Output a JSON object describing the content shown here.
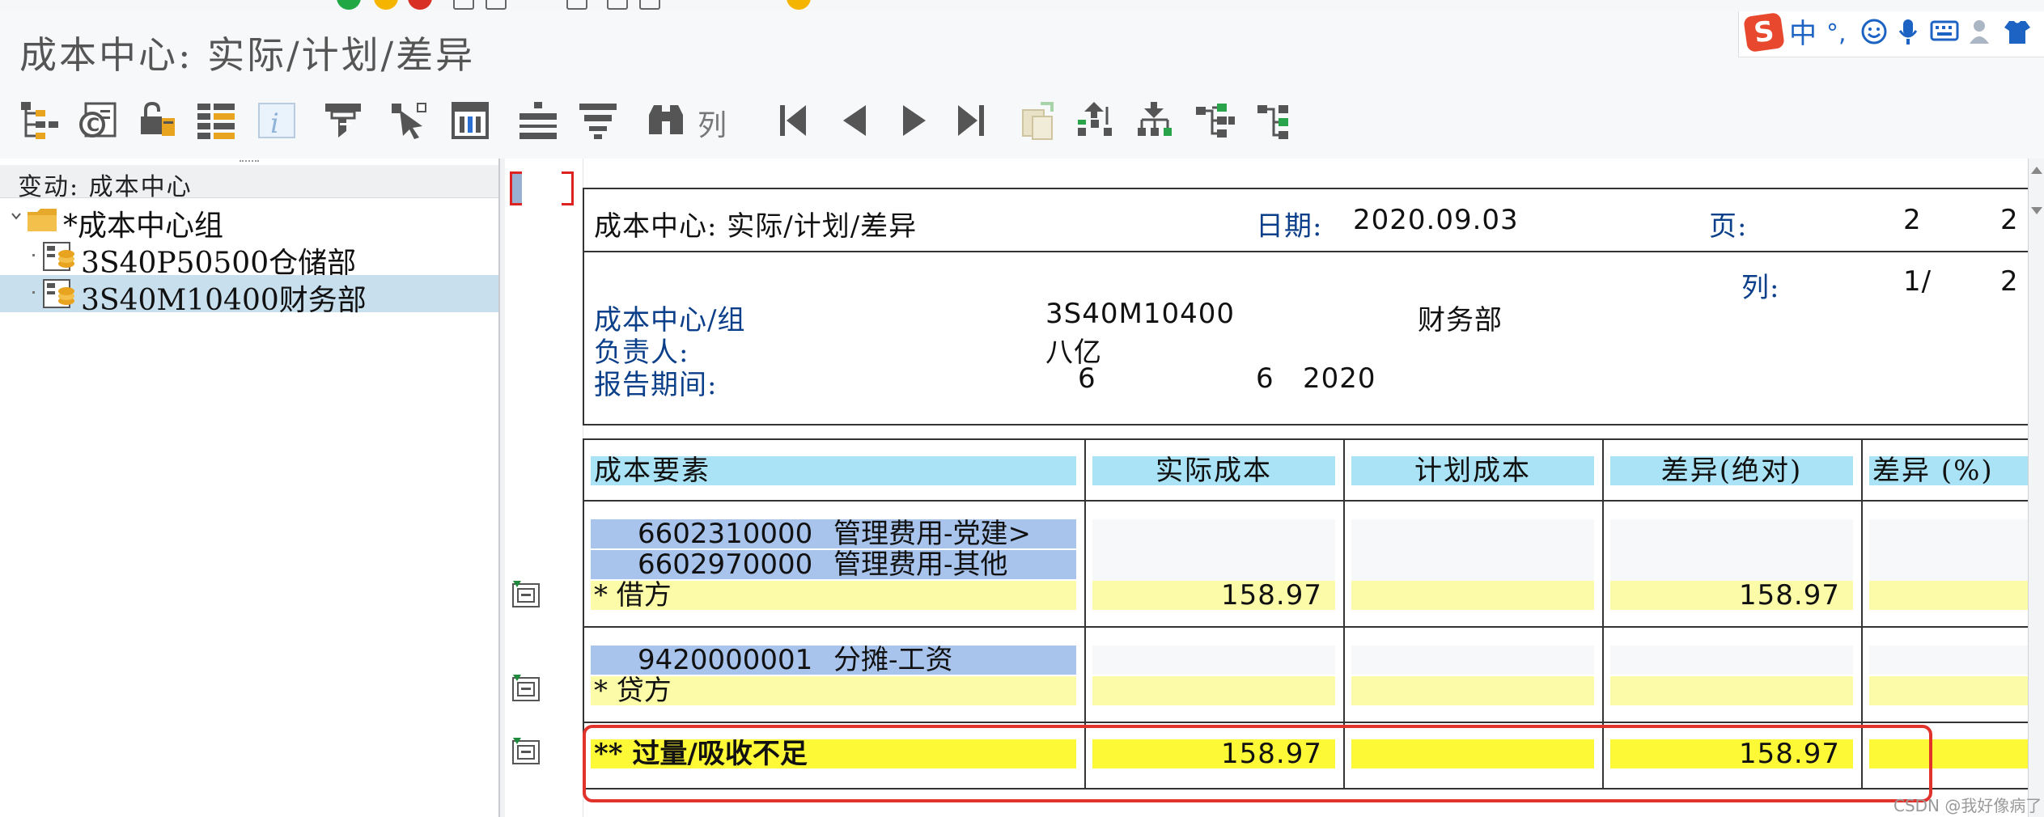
{
  "window": {
    "title": "成本中心: 实际/计划/差异"
  },
  "ime": {
    "mode": "中",
    "punct": "°,",
    "logo": "S"
  },
  "toolbar": {
    "column_label": "列"
  },
  "left_pane": {
    "header": "变动: 成本中心",
    "tree": [
      {
        "label": "*成本中心组",
        "level": 0,
        "selected": false
      },
      {
        "label": "3S40P50500仓储部",
        "level": 1,
        "selected": false
      },
      {
        "label": "3S40M10400财务部",
        "level": 1,
        "selected": true
      }
    ]
  },
  "report": {
    "title": "成本中心: 实际/计划/差异",
    "date_label": "日期:",
    "date_value": "2020.09.03",
    "page_label": "页:",
    "page_current": "2",
    "page_total": "2",
    "column_label": "列:",
    "column_current": "1/",
    "column_total": "2",
    "cost_center_label": "成本中心/组",
    "cost_center_code": "3S40M10400",
    "cost_center_name": "财务部",
    "responsible_label": "负责人:",
    "responsible_value": "八亿",
    "period_label": "报告期间:",
    "period_from": "6",
    "period_to": "6",
    "period_year": "2020"
  },
  "table": {
    "headers": [
      "成本要素",
      "实际成本",
      "计划成本",
      "差异(绝对)",
      "差异 (%)"
    ],
    "debit_items": [
      {
        "code": "6602310000",
        "name": "管理费用-党建>"
      },
      {
        "code": "6602970000",
        "name": "管理费用-其他"
      }
    ],
    "debit_total": {
      "label": "*  借方",
      "actual": "158.97",
      "plan": "",
      "variance_abs": "158.97",
      "variance_pct": ""
    },
    "credit_items": [
      {
        "code": "9420000001",
        "name": "分摊-工资"
      }
    ],
    "credit_total": {
      "label": "*  贷方",
      "actual": "",
      "plan": "",
      "variance_abs": "",
      "variance_pct": ""
    },
    "grand_total": {
      "label": "** 过量/吸收不足",
      "actual": "158.97",
      "plan": "",
      "variance_abs": "158.97",
      "variance_pct": ""
    }
  },
  "watermark": "CSDN @我好像病了",
  "colors": {
    "header_cell": "#a9e3f5",
    "gl_cell": "#a8c4ec",
    "subtotal_cell": "#fbfba8",
    "total_cell": "#fef936",
    "highlight_border": "#e2322c",
    "label_blue": "#0b3f8a"
  },
  "icons": [
    "hierarchy-icon",
    "change-layout-icon",
    "lock-icon",
    "list-settings-icon",
    "info-icon",
    "print-icon",
    "select-pointer-icon",
    "report-icon",
    "align-center-icon",
    "filter-icon",
    "binoculars-icon",
    "first-page-icon",
    "previous-page-icon",
    "next-page-icon",
    "last-page-icon",
    "copy-icon",
    "sort-ascending-icon",
    "sort-descending-icon",
    "expand-tree-icon",
    "collapse-tree-icon"
  ]
}
